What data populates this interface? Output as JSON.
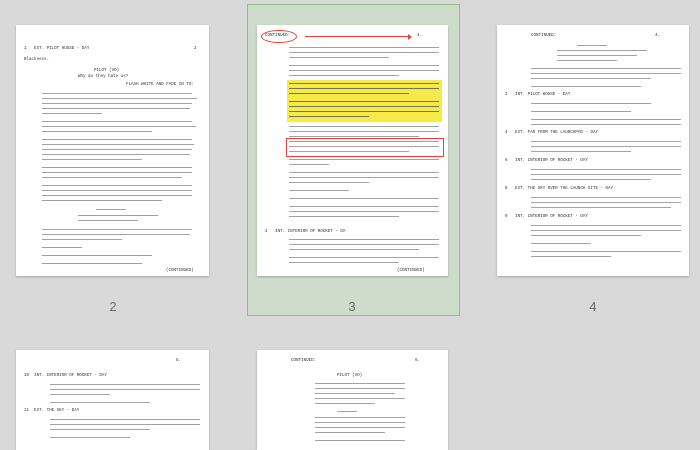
{
  "pages": [
    {
      "id": "page-2",
      "label": "2",
      "headline": "",
      "mark": "2"
    },
    {
      "id": "page-3",
      "label": "3",
      "headline": "CONTINUED:",
      "mark": "3."
    },
    {
      "id": "page-4",
      "label": "4",
      "headline": "CONTINUED:",
      "mark": "4."
    },
    {
      "id": "page-5",
      "label": "",
      "headline": "",
      "mark": "5."
    },
    {
      "id": "page-6",
      "label": "",
      "headline": "CONTINUED:",
      "mark": "6."
    }
  ],
  "page2": {
    "scene1": "1   EXT. PILOT HOUSE - DAY",
    "line1": "Blackness.",
    "pilot": "PILOT (VO)",
    "pilotline": "Why do they hate us?",
    "fade": "FLASH WHITE AND FADE IN TO:",
    "continued": "(CONTINUED)"
  },
  "page3": {
    "scene": "2   INT. INTERIOR OF ROCKET - DA",
    "continued": "(CONTINUED)"
  },
  "page4": {
    "scene2": "2   INT. PILOT HOUSE - DAY",
    "scene3": "4   EXT. FAR FROM THE LAUNCHPAD - DAY",
    "scene4": "6   INT. INTERIOR OF ROCKET - DAY",
    "scene5": "8   EXT. THE SKY OVER THE LAUNCH SITE - DAY",
    "scene6": "9   INT. INTERIOR OF ROCKET - DAY"
  },
  "page5": {
    "scene": "10  INT. INTERIOR OF ROCKET - DAY",
    "scene2": "11  EXT. THE SKY - DAY"
  },
  "page6": {
    "pilot": "PILOT (VO)"
  }
}
